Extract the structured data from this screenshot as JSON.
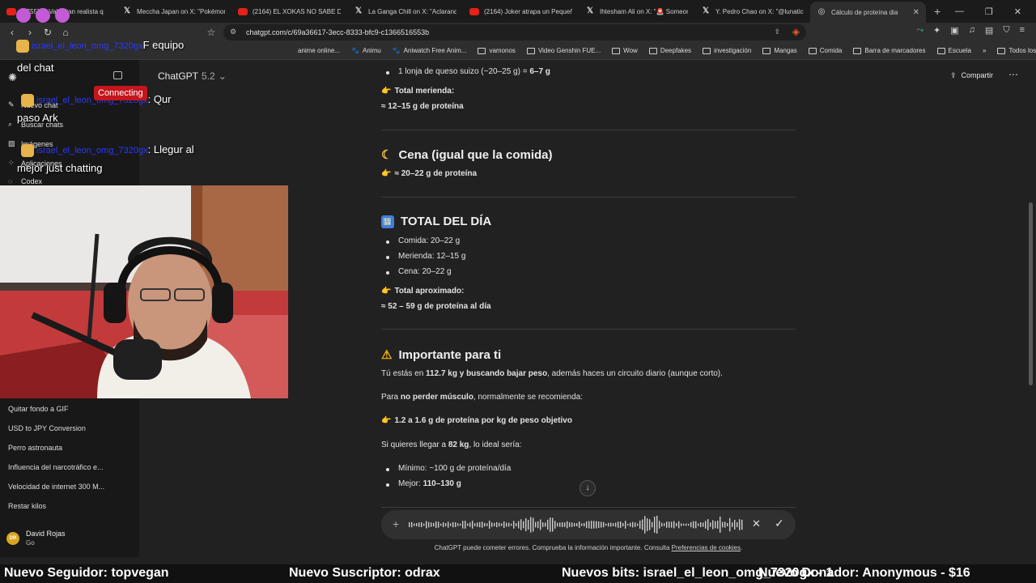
{
  "browser": {
    "tabs": [
      {
        "icon": "youtube-icon",
        "title": "[1755] Ni Vales tan realista q"
      },
      {
        "icon": "x-icon",
        "title": "Meccha Japan on X: \"Pokémon"
      },
      {
        "icon": "youtube-icon",
        "title": "(2164) EL XOKAS NO SABE DIV"
      },
      {
        "icon": "x-icon",
        "title": "La Ganga Chill on X: \"Aclarando"
      },
      {
        "icon": "youtube-icon",
        "title": "(2164) Joker atrapa un Pequeñ"
      },
      {
        "icon": "x-icon",
        "title": "Ihtesham Ali on X: \"🚨 Someon"
      },
      {
        "icon": "x-icon",
        "title": "Y. Pedro Chao on X: \"@lunatic"
      },
      {
        "icon": "chatgpt-icon",
        "title": "Cálculo de proteína dia"
      }
    ],
    "url": "chatgpt.com/c/69a36617-3ecc-8333-bfc9-c1366516553b",
    "bookmarks": [
      "anime online...",
      "Animu",
      "Aniwatch Free Anim...",
      "vamonos",
      "Video Genshin FUE...",
      "Wow",
      "Deepfakes",
      "investigación",
      "Mangas",
      "Comida",
      "Barra de marcadores",
      "Escuela"
    ],
    "favorites_label": "Todos los favoritos",
    "bookmark_overlay_text": "F equipo"
  },
  "sidebar": {
    "items": [
      {
        "icon": "new-chat-icon",
        "label": "Nuevo chat"
      },
      {
        "icon": "search-icon",
        "label": "Buscar chats"
      },
      {
        "icon": "images-icon",
        "label": "Imágenes"
      },
      {
        "icon": "apps-icon",
        "label": "Aplicaciones"
      },
      {
        "icon": "codex-icon",
        "label": "Codex"
      }
    ],
    "recents": [
      "Quitar fondo a GIF",
      "USD to JPY Conversion",
      "Perro astronauta",
      "Influencia del narcotráfico e...",
      "Velocidad de internet 300 M...",
      "Restar kilos"
    ],
    "user": {
      "initials": "DR",
      "name": "David Rojas",
      "plan": "Go"
    }
  },
  "header": {
    "model": "ChatGPT",
    "version": "5.2",
    "share": "Compartir"
  },
  "content": {
    "queso": "1 lonja de queso suizo (~20–25 g) = ",
    "queso_val": "6–7 g",
    "merienda_total_label": "Total merienda:",
    "merienda_total_val": "≈ 12–15 g de proteína",
    "cena_title": "Cena (igual que la comida)",
    "cena_val": "≈ 20–22 g de proteína",
    "total_title": "TOTAL DEL DÍA",
    "total_items": [
      "Comida: 20–22 g",
      "Merienda: 12–15 g",
      "Cena: 20–22 g"
    ],
    "aprox_label": "Total aproximado:",
    "aprox_val": "≈ 52 – 59 g de proteína al día",
    "importante_title": "Importante para ti",
    "p1_a": "Tú estás en ",
    "p1_b": "112.7 kg y buscando bajar peso",
    "p1_c": ", además haces un circuito diario (aunque corto).",
    "p2_a": "Para ",
    "p2_b": "no perder músculo",
    "p2_c": ", normalmente se recomienda:",
    "p3": "1.2 a 1.6 g de proteína por kg de peso objetivo",
    "p4_a": "Si quieres llegar a ",
    "p4_b": "82 kg",
    "p4_c": ", lo ideal sería:",
    "min_a": "Mínimo: ",
    "min_b": "~100 g de proteína/día",
    "mejor_a": "Mejor: ",
    "mejor_b": "110–130 g"
  },
  "composer": {
    "disclaimer": "ChatGPT puede cometer errores. Comprueba la información importante. Consulta ",
    "disclaimer_link": "Preferencias de cookies",
    "disclaimer_end": "."
  },
  "stream": {
    "chat_lines": [
      {
        "user": "israel_el_leon_omg_7320gx",
        "text": "F equipo"
      },
      {
        "user": "",
        "text": "del chat"
      },
      {
        "user": "israel_el_leon_omg_7320gx",
        "text": ": Qur"
      },
      {
        "user": "",
        "text": "paso Ark"
      },
      {
        "user": "israel_el_leon_omg_7320gx",
        "text": ": Llegur al"
      },
      {
        "user": "",
        "text": "mejor just chatting"
      }
    ],
    "connecting": "Connecting",
    "ticker": [
      "Nuevo Seguidor: topvegan",
      "Nuevo Suscriptor: odrax",
      "Nuevos bits: israel_el_leon_omg_7320gx - 1",
      "Nuevo Donador: Anonymous - $16"
    ]
  },
  "colors": {
    "bg": "#212121",
    "sidebar": "#181818",
    "accent_red": "#c4161c",
    "chat_user": "#2b38ff"
  }
}
